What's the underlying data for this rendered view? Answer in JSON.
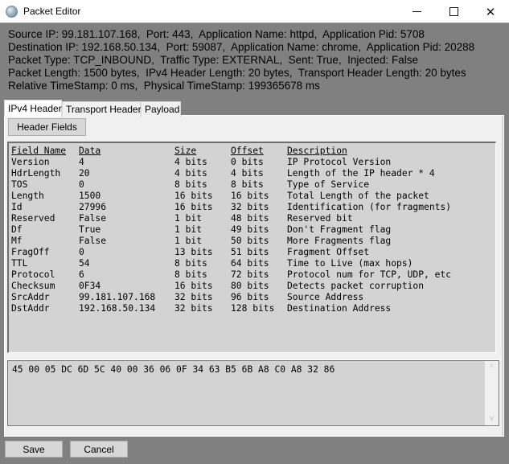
{
  "window": {
    "title": "Packet Editor",
    "icon": "globe-icon",
    "controls": {
      "minimize": "minimize-icon",
      "maximize": "maximize-icon",
      "close": "close-icon",
      "close_glyph": "✕"
    }
  },
  "info": {
    "lines": [
      "Source IP: 99.181.107.168,  Port: 443,  Application Name: httpd,  Application Pid: 5708",
      "Destination IP: 192.168.50.134,  Port: 59087,  Application Name: chrome,  Application Pid: 20288",
      "Packet Type: TCP_INBOUND,  Traffic Type: EXTERNAL,  Sent: True,  Injected: False",
      "Packet Length: 1500 bytes,  IPv4 Header Length: 20 bytes,  Transport Header Length: 20 bytes",
      "Relative TimeStamp: 0 ms,  Physical TimeStamp: 199365678 ms"
    ]
  },
  "tabs": [
    {
      "label": "IPv4 Header",
      "active": true
    },
    {
      "label": "Transport Header",
      "active": false
    },
    {
      "label": "Payload",
      "active": false
    }
  ],
  "header_fields_button": "Header Fields",
  "table": {
    "columns": [
      "Field Name",
      "Data",
      "Size",
      "Offset",
      "Description"
    ],
    "rows": [
      [
        "Version",
        "4",
        "4 bits",
        "0 bits",
        "IP Protocol Version"
      ],
      [
        "HdrLength",
        "20",
        "4 bits",
        "4 bits",
        "Length of the IP header * 4"
      ],
      [
        "TOS",
        "0",
        "8 bits",
        "8 bits",
        "Type of Service"
      ],
      [
        "Length",
        "1500",
        "16 bits",
        "16 bits",
        "Total Length of the packet"
      ],
      [
        "Id",
        "27996",
        "16 bits",
        "32 bits",
        "Identification (for fragments)"
      ],
      [
        "Reserved",
        "False",
        "1 bit",
        "48 bits",
        "Reserved bit"
      ],
      [
        "Df",
        "True",
        "1 bit",
        "49 bits",
        "Don't Fragment flag"
      ],
      [
        "Mf",
        "False",
        "1 bit",
        "50 bits",
        "More Fragments flag"
      ],
      [
        "FragOff",
        "0",
        "13 bits",
        "51 bits",
        "Fragment Offset"
      ],
      [
        "TTL",
        "54",
        "8 bits",
        "64 bits",
        "Time to Live (max hops)"
      ],
      [
        "Protocol",
        "6",
        "8 bits",
        "72 bits",
        "Protocol num for TCP, UDP, etc"
      ],
      [
        "Checksum",
        "0F34",
        "16 bits",
        "80 bits",
        "Detects packet corruption"
      ],
      [
        "SrcAddr",
        "99.181.107.168",
        "32 bits",
        "96 bits",
        "Source Address"
      ],
      [
        "DstAddr",
        "192.168.50.134",
        "32 bits",
        "128 bits",
        "Destination Address"
      ]
    ]
  },
  "hex": {
    "value": "45 00 05 DC 6D 5C 40 00 36 06 0F 34 63 B5 6B A8 C0 A8 32 86",
    "scroll_up": "^",
    "scroll_down": "v"
  },
  "buttons": {
    "save": "Save",
    "cancel": "Cancel"
  }
}
